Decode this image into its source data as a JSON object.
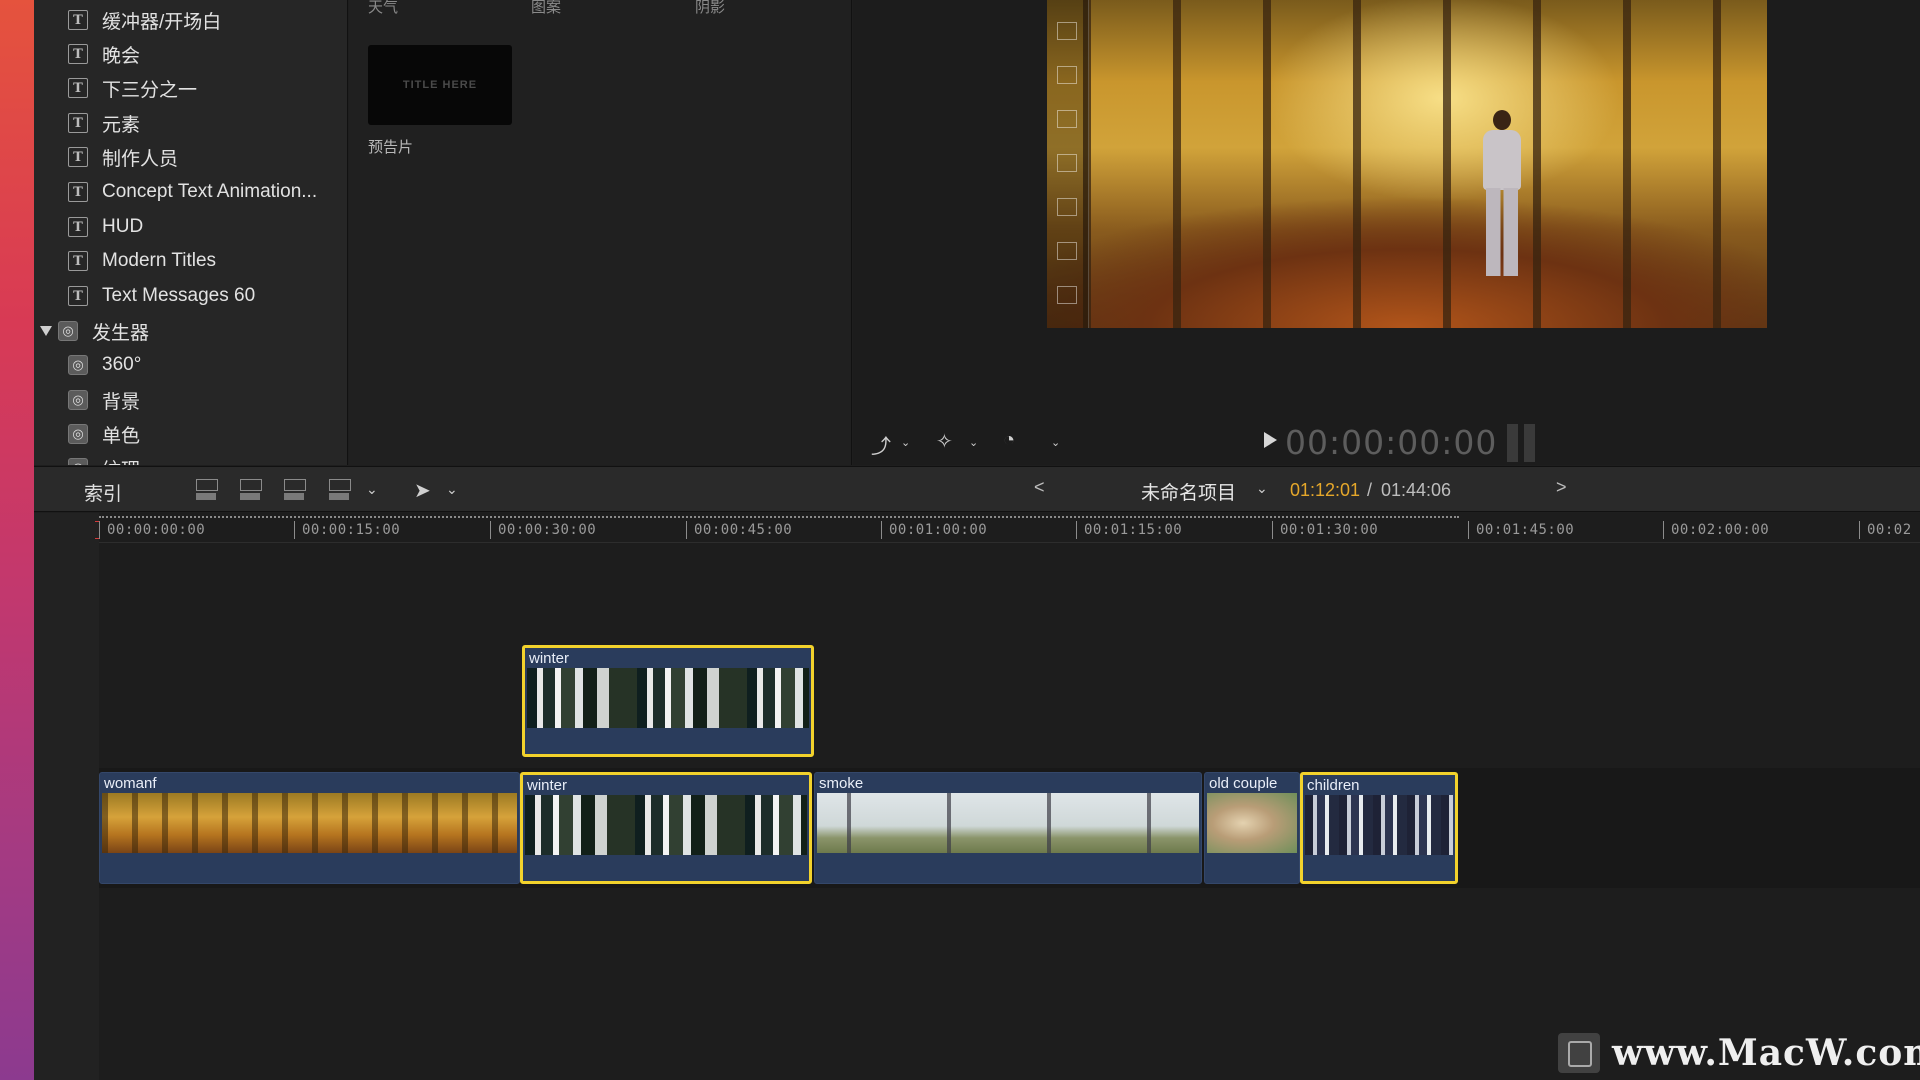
{
  "sidebar": {
    "items": [
      {
        "icon": "text-icon",
        "label": "缓冲器/开场白"
      },
      {
        "icon": "text-icon",
        "label": "晚会"
      },
      {
        "icon": "text-icon",
        "label": "下三分之一"
      },
      {
        "icon": "text-icon",
        "label": "元素"
      },
      {
        "icon": "text-icon",
        "label": "制作人员"
      },
      {
        "icon": "text-icon",
        "label": "Concept Text Animation..."
      },
      {
        "icon": "text-icon",
        "label": "HUD"
      },
      {
        "icon": "text-icon",
        "label": "Modern Titles"
      },
      {
        "icon": "text-icon",
        "label": "Text Messages 60"
      }
    ],
    "group": {
      "label": "发生器",
      "expanded": true
    },
    "sub_items": [
      {
        "icon": "generator-icon",
        "label": "360°"
      },
      {
        "icon": "generator-icon",
        "label": "背景"
      },
      {
        "icon": "generator-icon",
        "label": "单色"
      },
      {
        "icon": "generator-icon",
        "label": "纹理"
      }
    ]
  },
  "browser": {
    "column_headers": [
      "天气",
      "图案",
      "阴影"
    ],
    "thumbnail": {
      "text": "TITLE HERE",
      "label": "预告片"
    }
  },
  "viewer": {
    "timecode": "00:00:00:00"
  },
  "timeline_bar": {
    "index_label": "索引",
    "project_name": "未命名项目",
    "current_time": "01:12:01",
    "separator": " / ",
    "duration": "01:44:06",
    "prev": "<",
    "next": ">"
  },
  "ruler": {
    "labels": [
      "00:00:00:00",
      "00:00:15:00",
      "00:00:30:00",
      "00:00:45:00",
      "00:01:00:00",
      "00:01:15:00",
      "00:01:30:00",
      "00:01:45:00",
      "00:02:00:00",
      "00:02"
    ]
  },
  "clips": {
    "connected": {
      "name": "winter"
    },
    "primary": [
      {
        "name": "womanf",
        "selected": false
      },
      {
        "name": "winter",
        "selected": true
      },
      {
        "name": "smoke",
        "selected": false
      },
      {
        "name": "old couple",
        "selected": false
      },
      {
        "name": "children",
        "selected": true
      }
    ]
  },
  "colors": {
    "timecode_accent": "#e5a72a",
    "selection": "#f2d22c",
    "clip_fill": "#2a3c5c"
  },
  "watermark": "www.MacW.com"
}
